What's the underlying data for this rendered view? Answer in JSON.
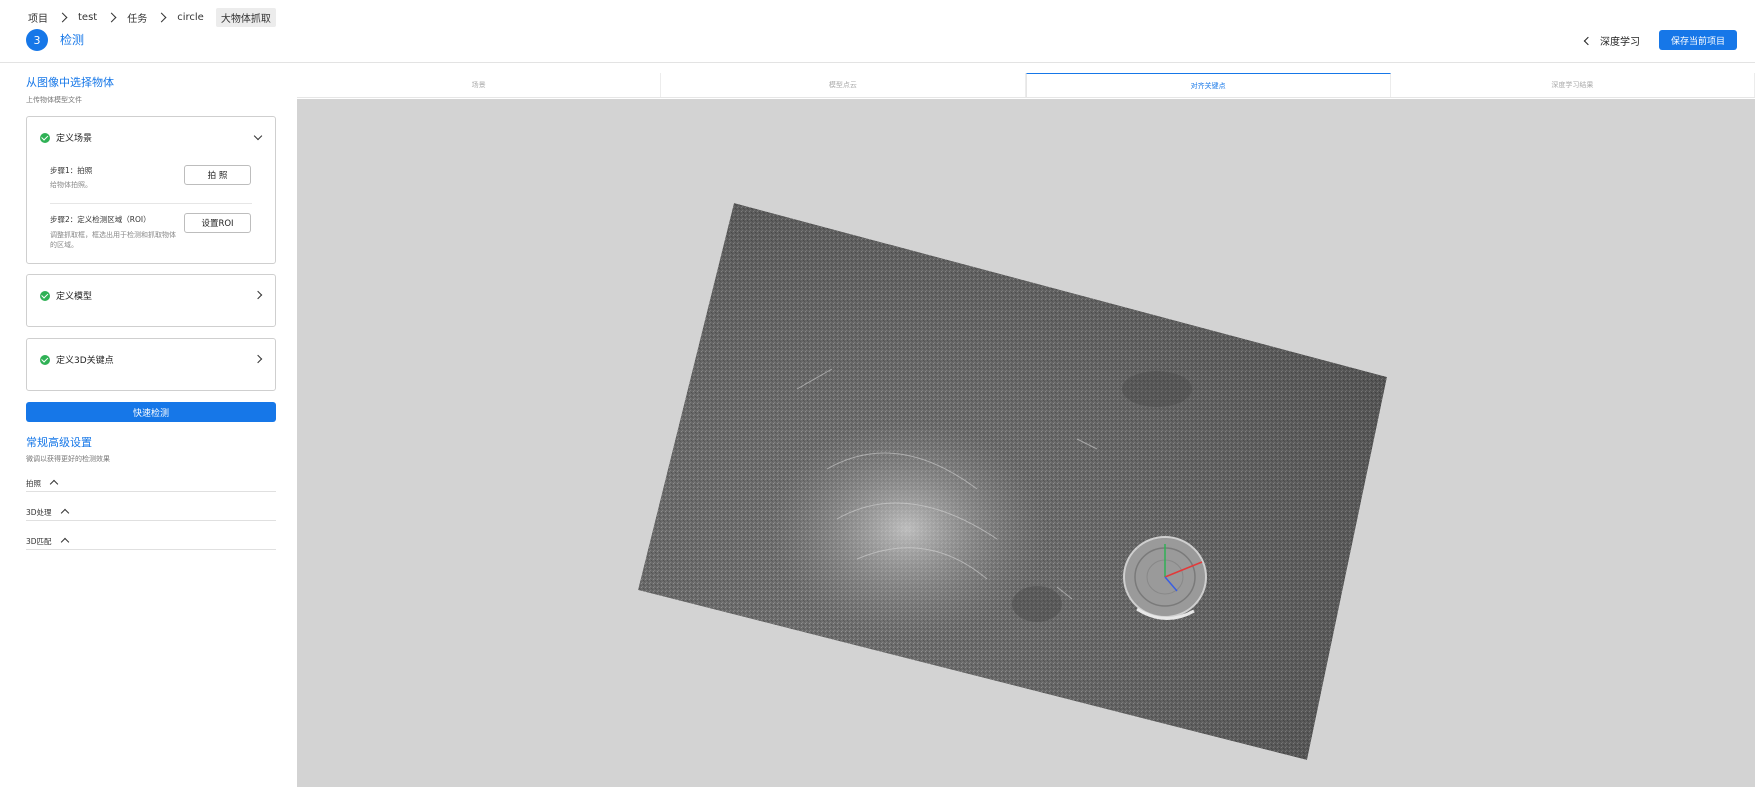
{
  "header": {
    "breadcrumb": [
      "项目",
      "test",
      "任务",
      "circle"
    ],
    "breadcrumb_current": "大物体抓取",
    "step_number": "3",
    "step_title": "检测",
    "back_label": "深度学习",
    "save_label": "保存当前项目"
  },
  "left": {
    "title": "从图像中选择物体",
    "subtitle": "上传物体模型文件",
    "card1": {
      "title": "定义场景",
      "step1_label": "步骤1：拍照",
      "step1_desc": "给物体拍照。",
      "step1_button": "拍 照",
      "step2_label": "步骤2：定义检测区域（ROI）",
      "step2_desc": "调整抓取框，框选出用于检测和抓取物体的区域。",
      "step2_button": "设置ROI"
    },
    "card2_title": "定义模型",
    "card3_title": "定义3D关键点",
    "quick_button": "快速检测",
    "adv_title": "常规高级设置",
    "adv_subtitle": "微调以获得更好的检测效果",
    "adv_rows": [
      "拍照",
      "3D处理",
      "3D匹配"
    ]
  },
  "tabs": [
    "场景",
    "模型点云",
    "对齐关键点",
    "深度学习结果"
  ],
  "active_tab": "对齐关键点",
  "colors": {
    "accent": "#1677e8",
    "success": "#2fb155",
    "viewer_bg": "#d3d3d3"
  }
}
